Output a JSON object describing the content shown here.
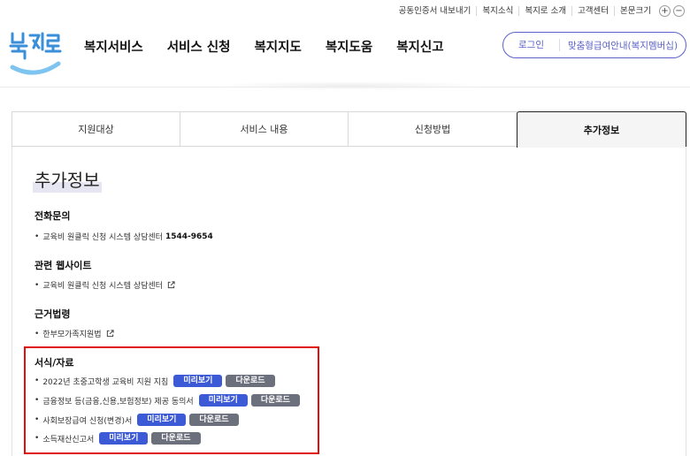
{
  "utility_nav": [
    "공동인증서 내보내기",
    "복지소식",
    "복지로 소개",
    "고객센터",
    "본문크기"
  ],
  "font_size_controls": [
    "+",
    "−"
  ],
  "logo": {
    "text": "복지로",
    "color": "#3a8fd8",
    "accent": "#7ec4f0"
  },
  "gnb": [
    "복지서비스",
    "서비스 신청",
    "복지지도",
    "복지도움",
    "복지신고"
  ],
  "auth": {
    "login": "로그인",
    "custom_info": "맞춤형급여안내(복지멤버십)",
    "color": "#5a62c8"
  },
  "tabs": [
    {
      "label": "지원대상",
      "active": false
    },
    {
      "label": "서비스 내용",
      "active": false
    },
    {
      "label": "신청방법",
      "active": false
    },
    {
      "label": "추가정보",
      "active": true
    }
  ],
  "content": {
    "title": "추가정보",
    "phone": {
      "heading": "전화문의",
      "item_text": "교육비 원클릭 신청 시스템 상담센터",
      "number": "1544-9654"
    },
    "website": {
      "heading": "관련 웹사이트",
      "item_text": "교육비 원클릭 신청 시스템 상담센터"
    },
    "law": {
      "heading": "근거법령",
      "item_text": "한부모가족지원법"
    },
    "forms": {
      "heading": "서식/자료",
      "preview_label": "미리보기",
      "download_label": "다운로드",
      "items": [
        "2022년 초중고학생 교육비 지원 지침",
        "금융정보 등(금융,신용,보험정보) 제공 동의서",
        "사회보장급여 신청(변경)서",
        "소득재산신고서"
      ]
    }
  },
  "colors": {
    "preview_button": "#3d5ad6",
    "download_button": "#6c6f7c",
    "highlight_box": "#e01010"
  }
}
